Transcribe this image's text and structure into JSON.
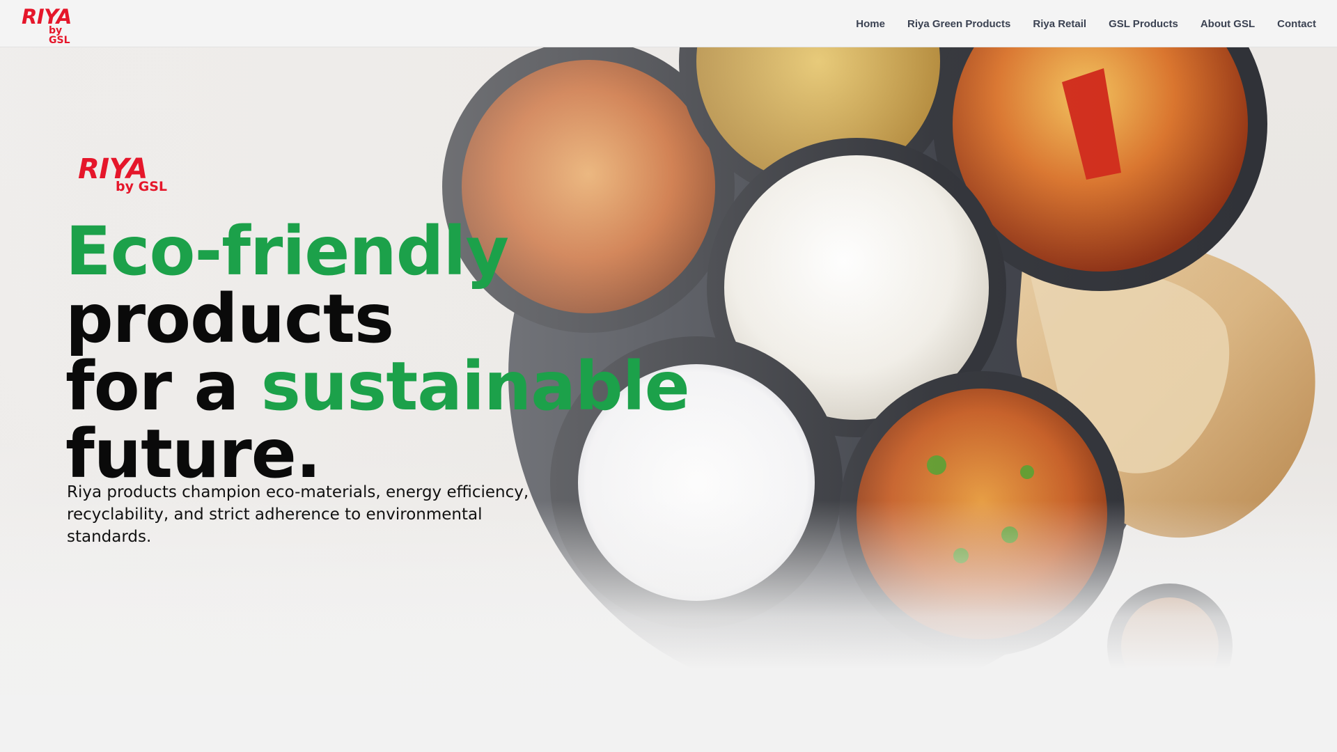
{
  "header": {
    "logo": {
      "brand": "RIYA",
      "sub": "by GSL"
    },
    "nav": [
      {
        "label": "Home"
      },
      {
        "label": "Riya Green Products"
      },
      {
        "label": "Riya Retail"
      },
      {
        "label": "GSL Products"
      },
      {
        "label": "About GSL"
      },
      {
        "label": "Contact"
      }
    ]
  },
  "hero": {
    "logo": {
      "brand": "RIYA",
      "sub": "by GSL"
    },
    "headline": {
      "part1": "Eco-friendly",
      "part2": " products",
      "part3": "for a ",
      "part4": "sustainable",
      "part5": "future."
    },
    "description": "Riya products champion eco-materials, energy efficiency, recyclability, and strict adherence to environmental standards.",
    "colors": {
      "accent_green": "#1ca14a",
      "brand_red": "#e5162a"
    }
  }
}
